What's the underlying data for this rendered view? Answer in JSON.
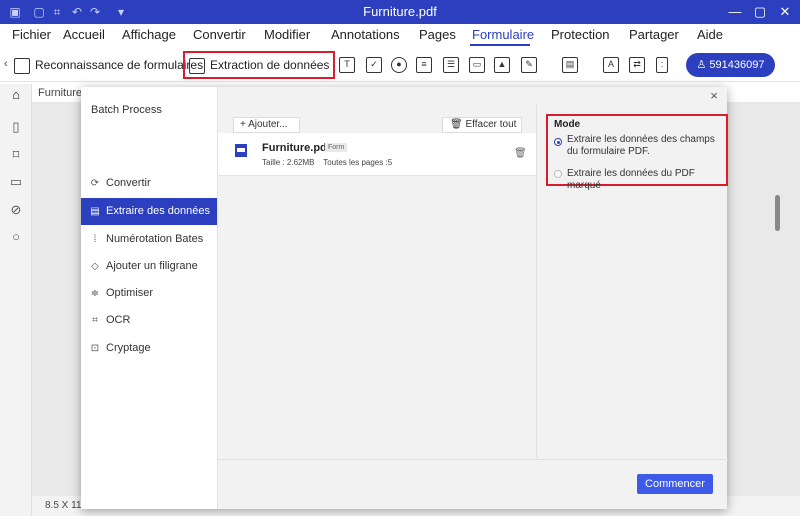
{
  "titlebar": {
    "title": "Furniture.pdf",
    "quick_icons": [
      "logo-icon",
      "save-icon",
      "crop-icon",
      "undo-icon",
      "redo-icon",
      "dropdown-icon"
    ],
    "window_controls": [
      "minimize-icon",
      "maximize-icon",
      "close-icon"
    ]
  },
  "menu": {
    "items": [
      "Fichier",
      "Accueil",
      "Affichage",
      "Convertir",
      "Modifier",
      "Annotations",
      "Pages",
      "Formulaire",
      "Protection",
      "Partager",
      "Aide"
    ],
    "active": "Formulaire"
  },
  "toolbar": {
    "recognition_label": "Reconnaissance de formulaires",
    "extraction_label": "Extraction de données",
    "user_label": "591436097"
  },
  "document": {
    "tab_label": "Furniture",
    "page_size": "8.5 X 11..."
  },
  "dialog": {
    "title": "Batch Process",
    "close": "×",
    "sidebar": [
      {
        "label": "Convertir",
        "icon": "convert-icon"
      },
      {
        "label": "Extraire des données",
        "icon": "extract-icon",
        "selected": true
      },
      {
        "label": "Numérotation Bates",
        "icon": "bates-icon"
      },
      {
        "label": "Ajouter un filigrane",
        "icon": "watermark-icon"
      },
      {
        "label": "Optimiser",
        "icon": "optimize-icon"
      },
      {
        "label": "OCR",
        "icon": "ocr-icon"
      },
      {
        "label": "Cryptage",
        "icon": "lock-icon"
      }
    ],
    "add_label": "Ajouter...",
    "clear_label": "Effacer tout",
    "file": {
      "name": "Furniture.pdf",
      "tag": "Form",
      "size": "Taille : 2.62MB",
      "pages": "Toutes les pages :5"
    },
    "mode": {
      "title": "Mode",
      "option1": "Extraire les données des champs du formulaire PDF.",
      "option2": "Extraire les données du PDF marqué"
    },
    "start_label": "Commencer"
  },
  "colors": {
    "brand": "#2b3fbf",
    "highlight": "#d81e2a",
    "start_button": "#3d5be8"
  }
}
